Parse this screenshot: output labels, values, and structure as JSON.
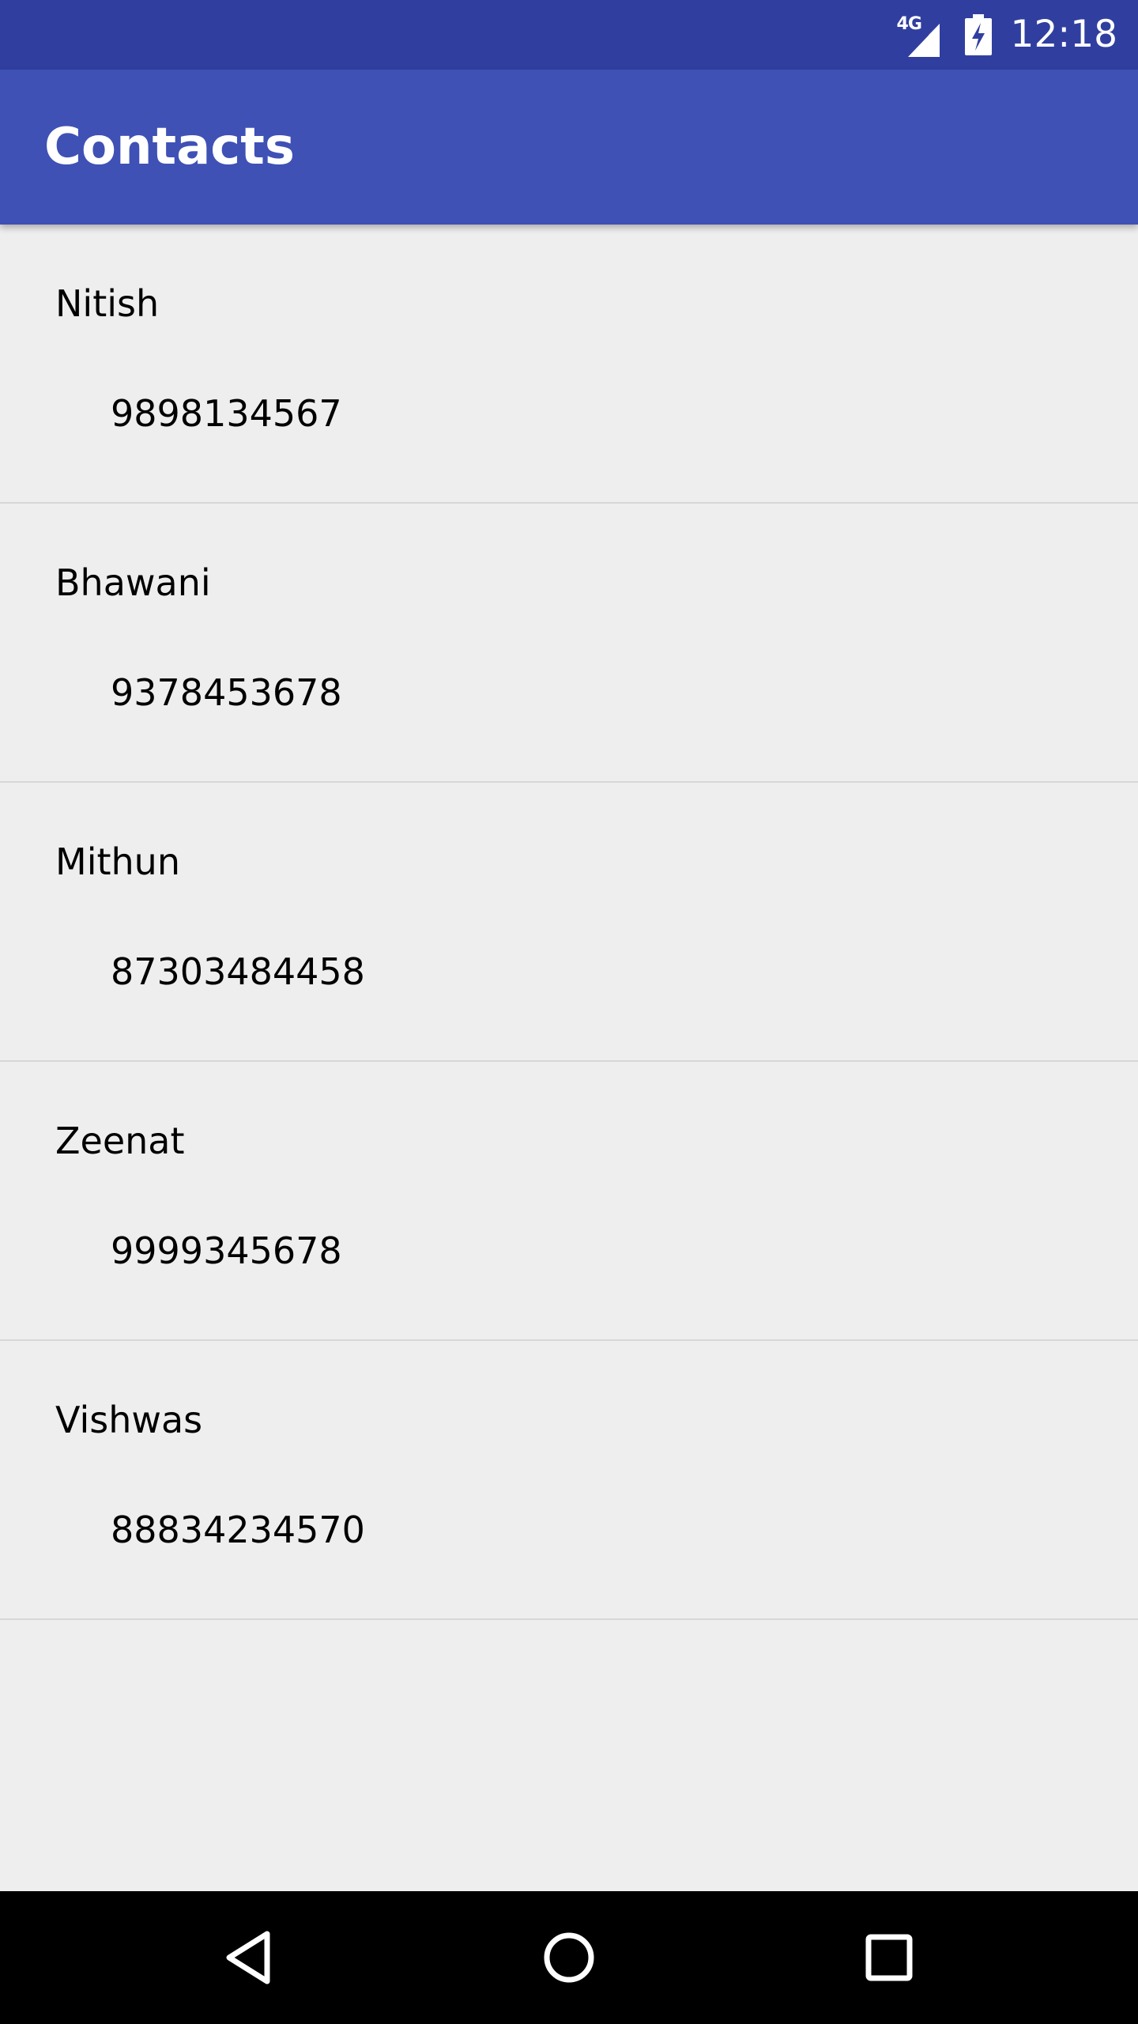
{
  "status_bar": {
    "network": "4G",
    "time": "12:18",
    "icons": [
      "signal-icon",
      "battery-charging-icon"
    ]
  },
  "app_bar": {
    "title": "Contacts",
    "color": "#3f51b5",
    "status_color": "#303f9f"
  },
  "contacts": [
    {
      "name": "Nitish",
      "phone": "9898134567"
    },
    {
      "name": "Bhawani",
      "phone": "9378453678"
    },
    {
      "name": "Mithun",
      "phone": "87303484458"
    },
    {
      "name": "Zeenat",
      "phone": "9999345678"
    },
    {
      "name": "Vishwas",
      "phone": "88834234570"
    }
  ],
  "nav_bar": {
    "icons": [
      "back-icon",
      "home-icon",
      "recents-icon"
    ]
  }
}
